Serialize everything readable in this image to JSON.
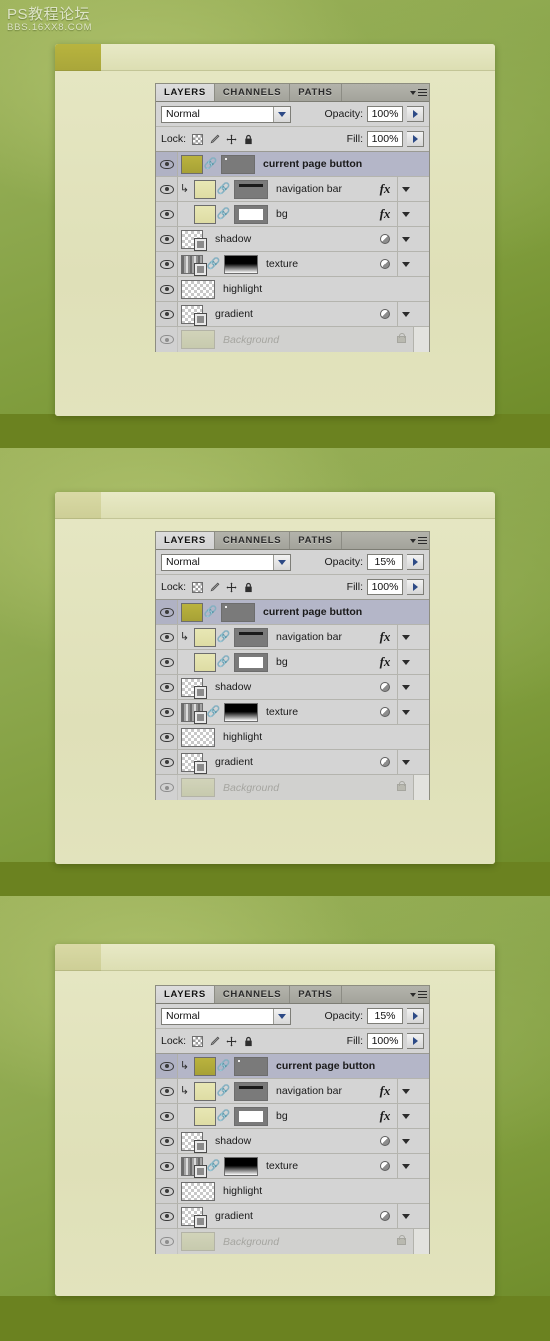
{
  "watermark": {
    "line1": "PS教程论坛",
    "line2": "BBS.16XX8.COM"
  },
  "panel": {
    "tabs": [
      {
        "label": "LAYERS",
        "active": true
      },
      {
        "label": "CHANNELS",
        "active": false
      },
      {
        "label": "PATHS",
        "active": false
      }
    ],
    "menu_icon": "panel-menu-icon",
    "blend_mode": "Normal",
    "opacity_label": "Opacity:",
    "fill_label": "Fill:",
    "lock_label": "Lock:",
    "lock_icons": [
      "transparency-checker-icon",
      "brush-icon",
      "move-icon",
      "lock-all-icon"
    ],
    "layers": [
      {
        "name": "current page button",
        "kind": "layer"
      },
      {
        "name": "navigation bar",
        "kind": "layer"
      },
      {
        "name": "bg",
        "kind": "layer"
      },
      {
        "name": "shadow",
        "kind": "group"
      },
      {
        "name": "texture",
        "kind": "layer"
      },
      {
        "name": "highlight",
        "kind": "layer"
      },
      {
        "name": "gradient",
        "kind": "group"
      },
      {
        "name": "Background",
        "kind": "background"
      }
    ]
  },
  "sections": [
    {
      "id": "step-1",
      "opacity_value": "100%",
      "fill_value": "100%",
      "tab_state": "active",
      "current_page_button_clipped": false
    },
    {
      "id": "step-2",
      "opacity_value": "15%",
      "fill_value": "100%",
      "tab_state": "faded",
      "current_page_button_clipped": false
    },
    {
      "id": "step-3",
      "opacity_value": "15%",
      "fill_value": "100%",
      "tab_state": "faded",
      "current_page_button_clipped": true
    }
  ],
  "colors": {
    "page_background": "#6b8220",
    "canvas_green": "#8da84e",
    "document_body": "#e3e4bd",
    "active_tab_olive": "#b8b43e",
    "panel_chrome": "#d4d4d4",
    "selected_row": "#b4b6c8"
  }
}
